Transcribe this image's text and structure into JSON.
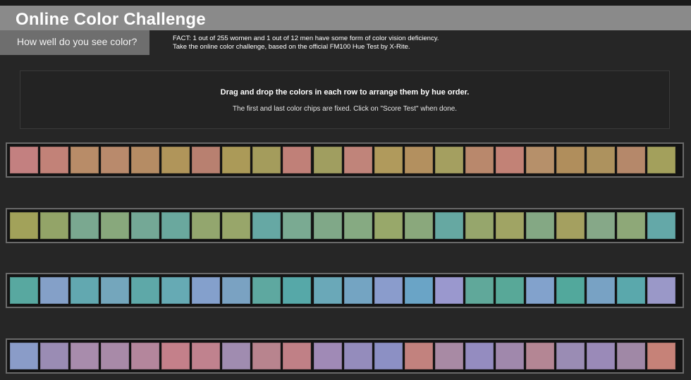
{
  "header": {
    "title": "Online Color Challenge",
    "subtitle": "How well do you see color?",
    "fact_line1": "FACT: 1 out of 255 women and 1 out of 12 men have some form of color vision deficiency.",
    "fact_line2": "Take the online color challenge, based on the official FM100 Hue Test by X-Rite."
  },
  "instructions": {
    "line1": "Drag and drop the colors in each row to arrange them by hue order.",
    "line2": "The first and last color chips are fixed. Click on \"Score Test\" when done."
  },
  "rows": [
    {
      "colors": [
        "#c38080",
        "#c28278",
        "#b88c68",
        "#b98a6c",
        "#b58c64",
        "#b0955a",
        "#b88070",
        "#ab9a58",
        "#a49c5c",
        "#c08078",
        "#a09e60",
        "#c0847a",
        "#b09a5c",
        "#b3905f",
        "#a49f60",
        "#b9886c",
        "#c28276",
        "#b6906a",
        "#b08e5c",
        "#ad925e",
        "#b5886a",
        "#a3a05c"
      ]
    },
    {
      "colors": [
        "#a2a25a",
        "#93a468",
        "#7aa890",
        "#88a87c",
        "#74a896",
        "#6aa89e",
        "#93a66e",
        "#98a66a",
        "#66a8a4",
        "#7aaa92",
        "#80a888",
        "#86aa82",
        "#98a86a",
        "#8aa87c",
        "#66a8a2",
        "#96a66c",
        "#a0a464",
        "#84a884",
        "#a4a060",
        "#86a888",
        "#8ea878",
        "#64a8a8"
      ]
    },
    {
      "colors": [
        "#58a8a0",
        "#84a0c8",
        "#62a8b0",
        "#74a6bc",
        "#5ea8a8",
        "#66aab4",
        "#84a0cc",
        "#7aa2c2",
        "#5ea8a0",
        "#56a8a8",
        "#6aa8b8",
        "#74a4c2",
        "#8a9ccc",
        "#6aa4c6",
        "#9a98ce",
        "#60a89a",
        "#58a898",
        "#82a2cc",
        "#52a89c",
        "#78a2c4",
        "#5aa8ac",
        "#9a98c8"
      ]
    },
    {
      "colors": [
        "#8a9cc8",
        "#9a8cb4",
        "#a88cac",
        "#a88aa8",
        "#b4869c",
        "#c4808a",
        "#c0828e",
        "#a08cb0",
        "#b8848e",
        "#c08086",
        "#a08ab6",
        "#948cbc",
        "#8c90c4",
        "#c2827e",
        "#a88aa4",
        "#948cc0",
        "#a088ac",
        "#b48694",
        "#9a8cb4",
        "#9a8ab8",
        "#a088a6",
        "#c68278"
      ]
    }
  ]
}
